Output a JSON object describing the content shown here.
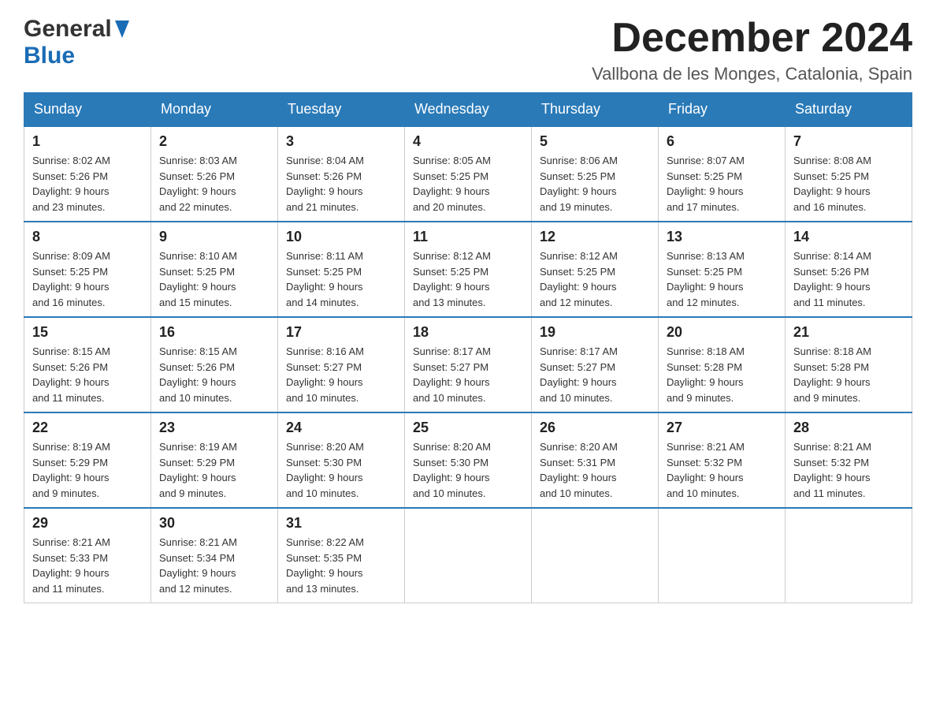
{
  "header": {
    "logo_general": "General",
    "logo_blue": "Blue",
    "month_title": "December 2024",
    "location": "Vallbona de les Monges, Catalonia, Spain"
  },
  "days_of_week": [
    "Sunday",
    "Monday",
    "Tuesday",
    "Wednesday",
    "Thursday",
    "Friday",
    "Saturday"
  ],
  "weeks": [
    [
      {
        "day": "1",
        "sunrise": "8:02 AM",
        "sunset": "5:26 PM",
        "daylight": "9 hours and 23 minutes."
      },
      {
        "day": "2",
        "sunrise": "8:03 AM",
        "sunset": "5:26 PM",
        "daylight": "9 hours and 22 minutes."
      },
      {
        "day": "3",
        "sunrise": "8:04 AM",
        "sunset": "5:26 PM",
        "daylight": "9 hours and 21 minutes."
      },
      {
        "day": "4",
        "sunrise": "8:05 AM",
        "sunset": "5:25 PM",
        "daylight": "9 hours and 20 minutes."
      },
      {
        "day": "5",
        "sunrise": "8:06 AM",
        "sunset": "5:25 PM",
        "daylight": "9 hours and 19 minutes."
      },
      {
        "day": "6",
        "sunrise": "8:07 AM",
        "sunset": "5:25 PM",
        "daylight": "9 hours and 17 minutes."
      },
      {
        "day": "7",
        "sunrise": "8:08 AM",
        "sunset": "5:25 PM",
        "daylight": "9 hours and 16 minutes."
      }
    ],
    [
      {
        "day": "8",
        "sunrise": "8:09 AM",
        "sunset": "5:25 PM",
        "daylight": "9 hours and 16 minutes."
      },
      {
        "day": "9",
        "sunrise": "8:10 AM",
        "sunset": "5:25 PM",
        "daylight": "9 hours and 15 minutes."
      },
      {
        "day": "10",
        "sunrise": "8:11 AM",
        "sunset": "5:25 PM",
        "daylight": "9 hours and 14 minutes."
      },
      {
        "day": "11",
        "sunrise": "8:12 AM",
        "sunset": "5:25 PM",
        "daylight": "9 hours and 13 minutes."
      },
      {
        "day": "12",
        "sunrise": "8:12 AM",
        "sunset": "5:25 PM",
        "daylight": "9 hours and 12 minutes."
      },
      {
        "day": "13",
        "sunrise": "8:13 AM",
        "sunset": "5:25 PM",
        "daylight": "9 hours and 12 minutes."
      },
      {
        "day": "14",
        "sunrise": "8:14 AM",
        "sunset": "5:26 PM",
        "daylight": "9 hours and 11 minutes."
      }
    ],
    [
      {
        "day": "15",
        "sunrise": "8:15 AM",
        "sunset": "5:26 PM",
        "daylight": "9 hours and 11 minutes."
      },
      {
        "day": "16",
        "sunrise": "8:15 AM",
        "sunset": "5:26 PM",
        "daylight": "9 hours and 10 minutes."
      },
      {
        "day": "17",
        "sunrise": "8:16 AM",
        "sunset": "5:27 PM",
        "daylight": "9 hours and 10 minutes."
      },
      {
        "day": "18",
        "sunrise": "8:17 AM",
        "sunset": "5:27 PM",
        "daylight": "9 hours and 10 minutes."
      },
      {
        "day": "19",
        "sunrise": "8:17 AM",
        "sunset": "5:27 PM",
        "daylight": "9 hours and 10 minutes."
      },
      {
        "day": "20",
        "sunrise": "8:18 AM",
        "sunset": "5:28 PM",
        "daylight": "9 hours and 9 minutes."
      },
      {
        "day": "21",
        "sunrise": "8:18 AM",
        "sunset": "5:28 PM",
        "daylight": "9 hours and 9 minutes."
      }
    ],
    [
      {
        "day": "22",
        "sunrise": "8:19 AM",
        "sunset": "5:29 PM",
        "daylight": "9 hours and 9 minutes."
      },
      {
        "day": "23",
        "sunrise": "8:19 AM",
        "sunset": "5:29 PM",
        "daylight": "9 hours and 9 minutes."
      },
      {
        "day": "24",
        "sunrise": "8:20 AM",
        "sunset": "5:30 PM",
        "daylight": "9 hours and 10 minutes."
      },
      {
        "day": "25",
        "sunrise": "8:20 AM",
        "sunset": "5:30 PM",
        "daylight": "9 hours and 10 minutes."
      },
      {
        "day": "26",
        "sunrise": "8:20 AM",
        "sunset": "5:31 PM",
        "daylight": "9 hours and 10 minutes."
      },
      {
        "day": "27",
        "sunrise": "8:21 AM",
        "sunset": "5:32 PM",
        "daylight": "9 hours and 10 minutes."
      },
      {
        "day": "28",
        "sunrise": "8:21 AM",
        "sunset": "5:32 PM",
        "daylight": "9 hours and 11 minutes."
      }
    ],
    [
      {
        "day": "29",
        "sunrise": "8:21 AM",
        "sunset": "5:33 PM",
        "daylight": "9 hours and 11 minutes."
      },
      {
        "day": "30",
        "sunrise": "8:21 AM",
        "sunset": "5:34 PM",
        "daylight": "9 hours and 12 minutes."
      },
      {
        "day": "31",
        "sunrise": "8:22 AM",
        "sunset": "5:35 PM",
        "daylight": "9 hours and 13 minutes."
      },
      null,
      null,
      null,
      null
    ]
  ],
  "labels": {
    "sunrise": "Sunrise:",
    "sunset": "Sunset:",
    "daylight": "Daylight:"
  }
}
